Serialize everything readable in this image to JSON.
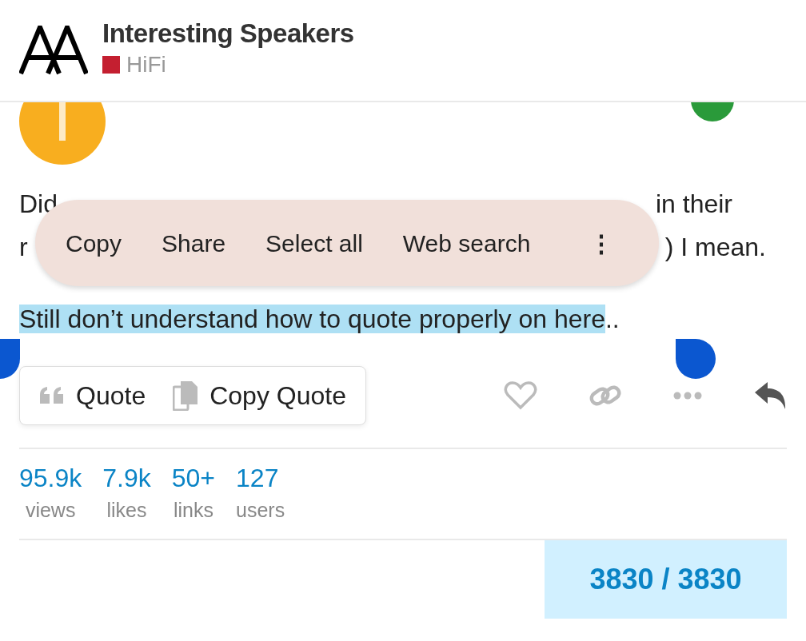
{
  "header": {
    "title": "Interesting Speakers",
    "category": {
      "name": "HiFi",
      "color": "#c41f30"
    }
  },
  "post": {
    "line1_start": "Did",
    "line1_end": "in their",
    "line2_start": "r",
    "line2_end": ") I mean.",
    "selected_text": "Still don’t understand how to quote properly on here",
    "after_selection": ".."
  },
  "text_menu": {
    "items": [
      "Copy",
      "Share",
      "Select all",
      "Web search"
    ],
    "more": "⋮"
  },
  "quote_menu": {
    "items": [
      {
        "kind": "quote",
        "label": "Quote"
      },
      {
        "kind": "copy",
        "label": "Copy Quote"
      }
    ]
  },
  "stats": [
    {
      "value": "95.9k",
      "label": "views"
    },
    {
      "value": "7.9k",
      "label": "likes"
    },
    {
      "value": "50+",
      "label": "links"
    },
    {
      "value": "127",
      "label": "users"
    }
  ],
  "progress": "3830 / 3830"
}
